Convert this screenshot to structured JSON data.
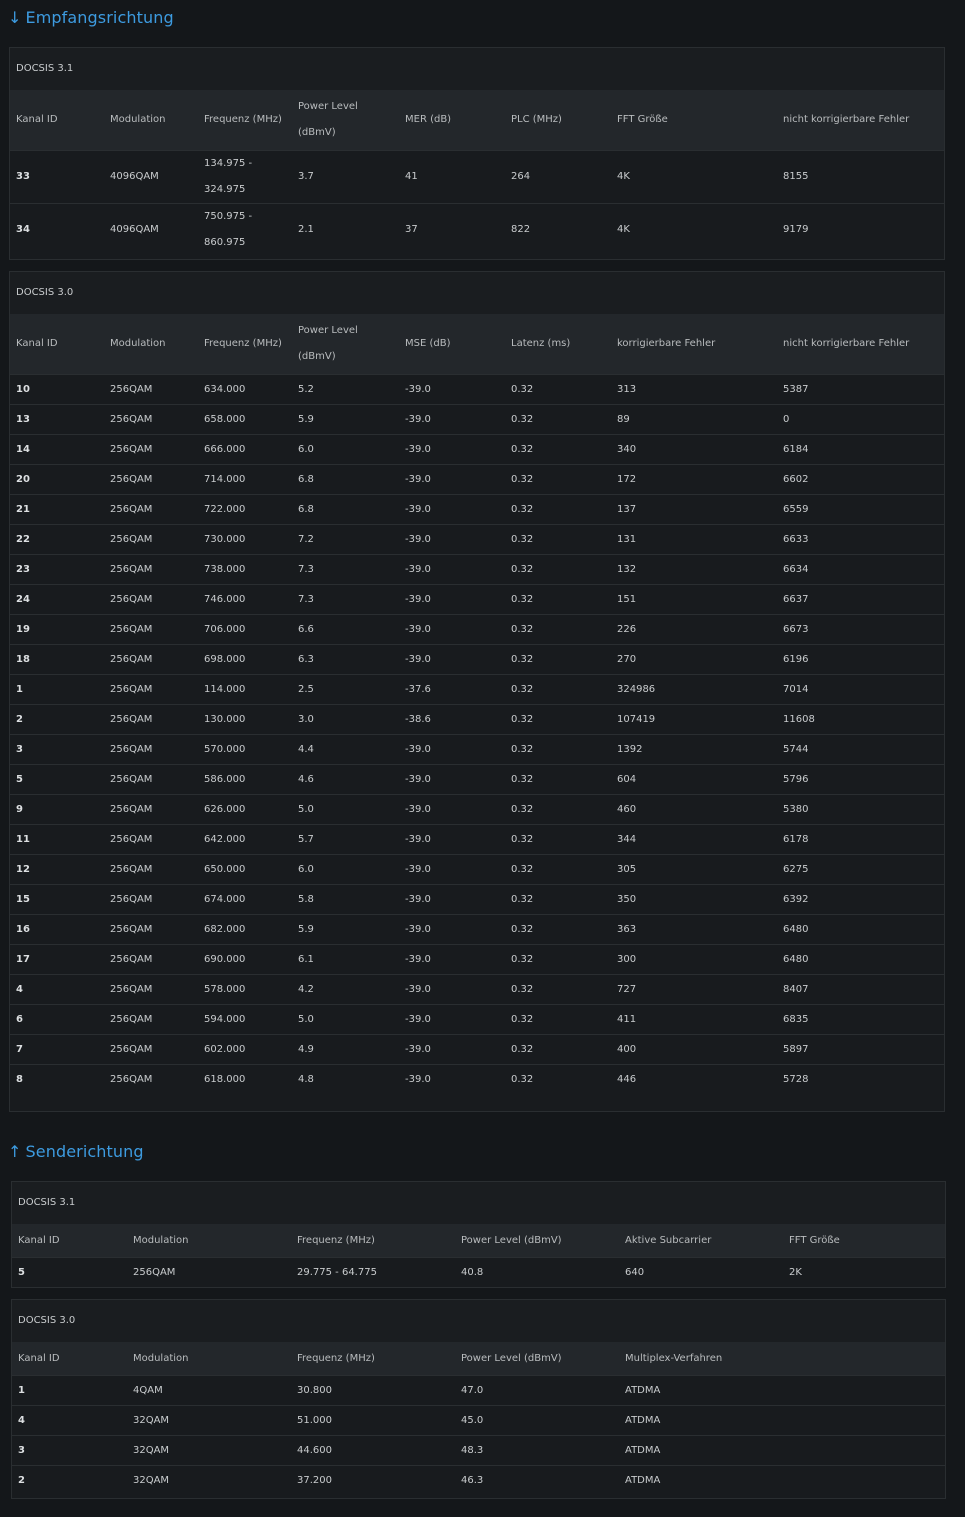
{
  "downstream": {
    "title": "Empfangsrichtung",
    "arrow": "↓",
    "docsis31": {
      "caption": "DOCSIS 3.1",
      "headers": [
        "Kanal ID",
        "Modulation",
        "Frequenz (MHz)",
        "Power Level (dBmV)",
        "MER (dB)",
        "PLC (MHz)",
        "FFT Größe",
        "nicht korrigierbare Fehler"
      ],
      "rows": [
        [
          "33",
          "4096QAM",
          "134.975 - 324.975",
          "3.7",
          "41",
          "264",
          "4K",
          "8155"
        ],
        [
          "34",
          "4096QAM",
          "750.975 - 860.975",
          "2.1",
          "37",
          "822",
          "4K",
          "9179"
        ]
      ]
    },
    "docsis30": {
      "caption": "DOCSIS 3.0",
      "headers": [
        "Kanal ID",
        "Modulation",
        "Frequenz (MHz)",
        "Power Level (dBmV)",
        "MSE (dB)",
        "Latenz (ms)",
        "korrigierbare Fehler",
        "nicht korrigierbare Fehler"
      ],
      "rows": [
        [
          "10",
          "256QAM",
          "634.000",
          "5.2",
          "-39.0",
          "0.32",
          "313",
          "5387"
        ],
        [
          "13",
          "256QAM",
          "658.000",
          "5.9",
          "-39.0",
          "0.32",
          "89",
          "0"
        ],
        [
          "14",
          "256QAM",
          "666.000",
          "6.0",
          "-39.0",
          "0.32",
          "340",
          "6184"
        ],
        [
          "20",
          "256QAM",
          "714.000",
          "6.8",
          "-39.0",
          "0.32",
          "172",
          "6602"
        ],
        [
          "21",
          "256QAM",
          "722.000",
          "6.8",
          "-39.0",
          "0.32",
          "137",
          "6559"
        ],
        [
          "22",
          "256QAM",
          "730.000",
          "7.2",
          "-39.0",
          "0.32",
          "131",
          "6633"
        ],
        [
          "23",
          "256QAM",
          "738.000",
          "7.3",
          "-39.0",
          "0.32",
          "132",
          "6634"
        ],
        [
          "24",
          "256QAM",
          "746.000",
          "7.3",
          "-39.0",
          "0.32",
          "151",
          "6637"
        ],
        [
          "19",
          "256QAM",
          "706.000",
          "6.6",
          "-39.0",
          "0.32",
          "226",
          "6673"
        ],
        [
          "18",
          "256QAM",
          "698.000",
          "6.3",
          "-39.0",
          "0.32",
          "270",
          "6196"
        ],
        [
          "1",
          "256QAM",
          "114.000",
          "2.5",
          "-37.6",
          "0.32",
          "324986",
          "7014"
        ],
        [
          "2",
          "256QAM",
          "130.000",
          "3.0",
          "-38.6",
          "0.32",
          "107419",
          "11608"
        ],
        [
          "3",
          "256QAM",
          "570.000",
          "4.4",
          "-39.0",
          "0.32",
          "1392",
          "5744"
        ],
        [
          "5",
          "256QAM",
          "586.000",
          "4.6",
          "-39.0",
          "0.32",
          "604",
          "5796"
        ],
        [
          "9",
          "256QAM",
          "626.000",
          "5.0",
          "-39.0",
          "0.32",
          "460",
          "5380"
        ],
        [
          "11",
          "256QAM",
          "642.000",
          "5.7",
          "-39.0",
          "0.32",
          "344",
          "6178"
        ],
        [
          "12",
          "256QAM",
          "650.000",
          "6.0",
          "-39.0",
          "0.32",
          "305",
          "6275"
        ],
        [
          "15",
          "256QAM",
          "674.000",
          "5.8",
          "-39.0",
          "0.32",
          "350",
          "6392"
        ],
        [
          "16",
          "256QAM",
          "682.000",
          "5.9",
          "-39.0",
          "0.32",
          "363",
          "6480"
        ],
        [
          "17",
          "256QAM",
          "690.000",
          "6.1",
          "-39.0",
          "0.32",
          "300",
          "6480"
        ],
        [
          "4",
          "256QAM",
          "578.000",
          "4.2",
          "-39.0",
          "0.32",
          "727",
          "8407"
        ],
        [
          "6",
          "256QAM",
          "594.000",
          "5.0",
          "-39.0",
          "0.32",
          "411",
          "6835"
        ],
        [
          "7",
          "256QAM",
          "602.000",
          "4.9",
          "-39.0",
          "0.32",
          "400",
          "5897"
        ],
        [
          "8",
          "256QAM",
          "618.000",
          "4.8",
          "-39.0",
          "0.32",
          "446",
          "5728"
        ]
      ]
    }
  },
  "upstream": {
    "title": "Senderichtung",
    "arrow": "↑",
    "docsis31": {
      "caption": "DOCSIS 3.1",
      "headers": [
        "Kanal ID",
        "Modulation",
        "Frequenz (MHz)",
        "Power Level (dBmV)",
        "Aktive Subcarrier",
        "FFT Größe"
      ],
      "rows": [
        [
          "5",
          "256QAM",
          "29.775 - 64.775",
          "40.8",
          "640",
          "2K"
        ]
      ]
    },
    "docsis30": {
      "caption": "DOCSIS 3.0",
      "headers": [
        "Kanal ID",
        "Modulation",
        "Frequenz (MHz)",
        "Power Level (dBmV)",
        "Multiplex-Verfahren"
      ],
      "rows": [
        [
          "1",
          "4QAM",
          "30.800",
          "47.0",
          "ATDMA"
        ],
        [
          "4",
          "32QAM",
          "51.000",
          "45.0",
          "ATDMA"
        ],
        [
          "3",
          "32QAM",
          "44.600",
          "48.3",
          "ATDMA"
        ],
        [
          "2",
          "32QAM",
          "37.200",
          "46.3",
          "ATDMA"
        ]
      ]
    }
  },
  "colors": {
    "accent": "#3d9be0",
    "background": "#14171a",
    "header_row": "#23272b"
  }
}
